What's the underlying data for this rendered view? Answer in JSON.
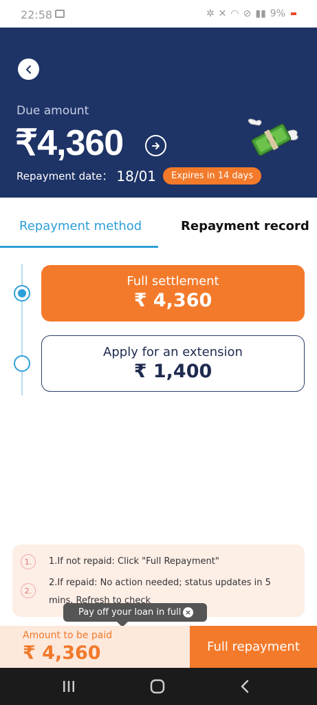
{
  "status_bar": {
    "time": "22:58",
    "battery": "9%"
  },
  "header": {
    "due_label": "Due amount",
    "due_amount": "₹4,360",
    "repayment_label": "Repayment date：",
    "repayment_date": "18/01",
    "expire_badge": "Expires in 14 days"
  },
  "tabs": [
    {
      "label": "Repayment method",
      "active": true
    },
    {
      "label": "Repayment record",
      "active": false
    }
  ],
  "options": [
    {
      "title": "Full settlement",
      "amount": "₹ 4,360",
      "selected": true
    },
    {
      "title": "Apply for an extension",
      "amount": "₹ 1,400",
      "selected": false
    }
  ],
  "info": [
    {
      "num": "1.",
      "text": "1.If not repaid: Click \"Full Repayment\""
    },
    {
      "num": "2.",
      "text": "2.If repaid: No action needed; status updates in 5 mins. Refresh to check"
    }
  ],
  "tooltip": {
    "text": "Pay off your loan in full",
    "close": "×"
  },
  "bottom": {
    "amount_label": "Amount to be paid",
    "amount_value": "₹ 4,360",
    "button_label": "Full repayment"
  },
  "colors": {
    "header_bg": "#1e3366",
    "accent_orange": "#f47a2b",
    "accent_blue": "#2d9fd8"
  },
  "icons": [
    "back-arrow-icon",
    "arrow-right-circle-icon",
    "flying-money-icon",
    "close-icon",
    "recent-apps-icon",
    "home-icon",
    "back-icon"
  ]
}
